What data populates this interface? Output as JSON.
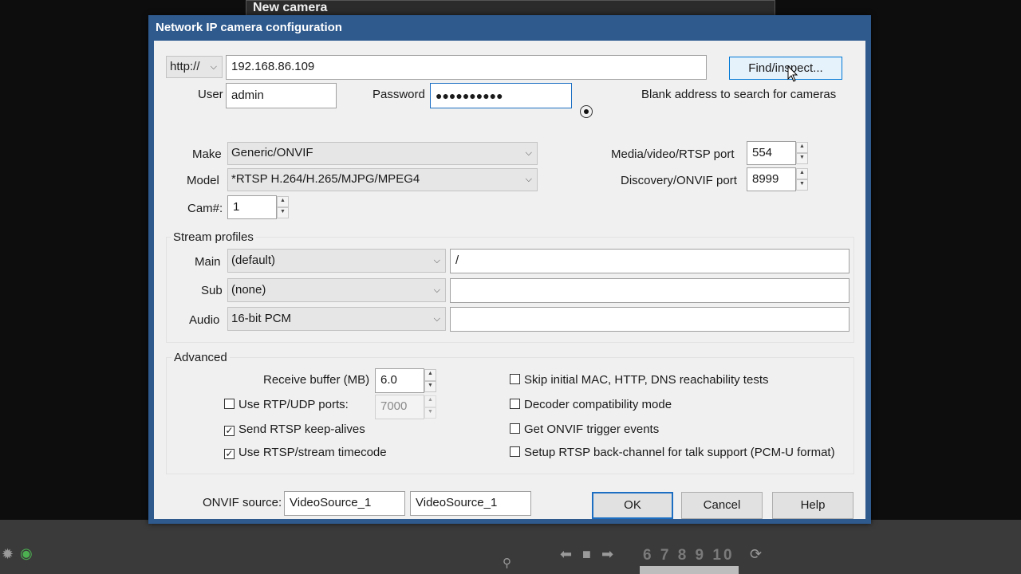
{
  "background_window": {
    "title": "New camera"
  },
  "dialog": {
    "title": "Network IP camera configuration",
    "protocol": "http://",
    "address": "192.168.86.109",
    "find_button": "Find/inspect...",
    "user_label": "User",
    "user_value": "admin",
    "password_label": "Password",
    "password_value": "●●●●●●●●●●",
    "search_hint": "Blank address to search for cameras",
    "make_label": "Make",
    "make_value": "Generic/ONVIF",
    "model_label": "Model",
    "model_value": "*RTSP H.264/H.265/MJPG/MPEG4",
    "cam_label": "Cam#:",
    "cam_value": "1",
    "media_port_label": "Media/video/RTSP port",
    "media_port_value": "554",
    "discovery_port_label": "Discovery/ONVIF port",
    "discovery_port_value": "8999",
    "stream_profiles": {
      "title": "Stream profiles",
      "main_label": "Main",
      "main_value": "(default)",
      "main_path": "/",
      "sub_label": "Sub",
      "sub_value": "(none)",
      "sub_path": "",
      "audio_label": "Audio",
      "audio_value": "16-bit PCM",
      "audio_path": ""
    },
    "advanced": {
      "title": "Advanced",
      "receive_buffer_label": "Receive buffer (MB)",
      "receive_buffer_value": "6.0",
      "rtp_udp_label": "Use RTP/UDP ports:",
      "rtp_udp_checked": false,
      "rtp_udp_value": "7000",
      "keepalive_label": "Send RTSP keep-alives",
      "keepalive_checked": true,
      "timecode_label": "Use RTSP/stream timecode",
      "timecode_checked": true,
      "skip_tests_label": "Skip initial MAC, HTTP, DNS reachability tests",
      "skip_tests_checked": false,
      "decoder_compat_label": "Decoder compatibility mode",
      "decoder_compat_checked": false,
      "onvif_trigger_label": "Get ONVIF trigger events",
      "onvif_trigger_checked": false,
      "backchannel_label": "Setup RTSP back-channel for talk support (PCM-U format)",
      "backchannel_checked": false
    },
    "onvif_source_label": "ONVIF source:",
    "onvif_source_1": "VideoSource_1",
    "onvif_source_2": "VideoSource_1",
    "ok_button": "OK",
    "cancel_button": "Cancel",
    "help_button": "Help"
  },
  "taskbar": {
    "page_numbers": "6 7 8 9 10"
  },
  "colors": {
    "dialog_frame": "#2e5a8e",
    "focus_border": "#1b6ec2",
    "dialog_bg": "#f0f0f0"
  }
}
